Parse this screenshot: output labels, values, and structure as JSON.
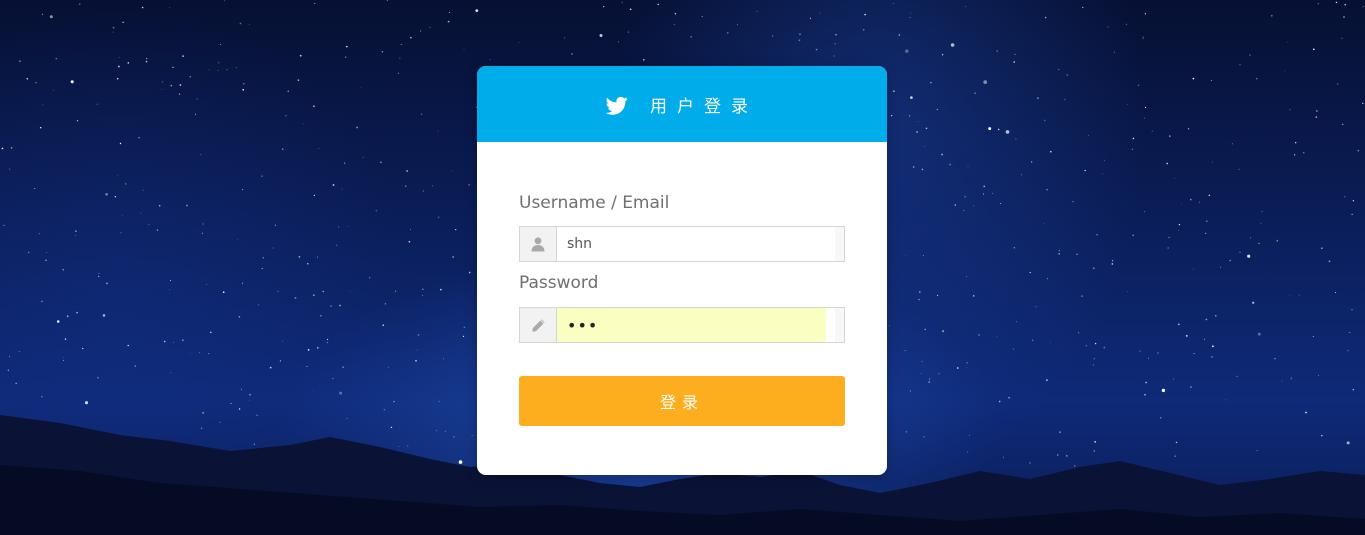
{
  "header": {
    "title": "用户登录",
    "logo_icon": "twitter-bird-icon"
  },
  "form": {
    "username_label": "Username / Email",
    "username_value": "shn",
    "username_icon": "user-icon",
    "password_label": "Password",
    "password_value": "•••",
    "password_icon": "pencil-icon",
    "submit_label": "登录"
  },
  "colors": {
    "header_bg": "#00adea",
    "button_bg": "#fdae1f",
    "password_autofill_bg": "#fafec0"
  }
}
